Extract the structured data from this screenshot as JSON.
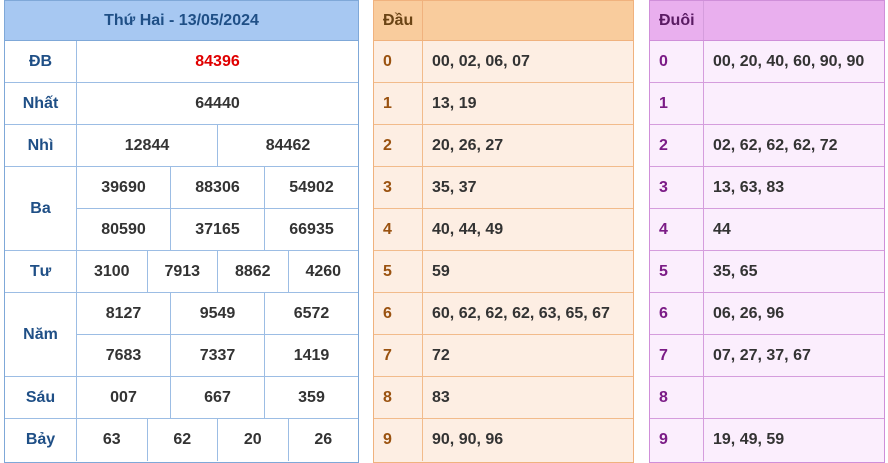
{
  "results": {
    "title": "Thứ Hai - 13/05/2024",
    "prizes": [
      {
        "label": "ĐB",
        "lines": [
          [
            "84396"
          ]
        ]
      },
      {
        "label": "Nhất",
        "lines": [
          [
            "64440"
          ]
        ]
      },
      {
        "label": "Nhì",
        "lines": [
          [
            "12844",
            "84462"
          ]
        ]
      },
      {
        "label": "Ba",
        "lines": [
          [
            "39690",
            "88306",
            "54902"
          ],
          [
            "80590",
            "37165",
            "66935"
          ]
        ]
      },
      {
        "label": "Tư",
        "lines": [
          [
            "3100",
            "7913",
            "8862",
            "4260"
          ]
        ]
      },
      {
        "label": "Năm",
        "lines": [
          [
            "8127",
            "9549",
            "6572"
          ],
          [
            "7683",
            "7337",
            "1419"
          ]
        ]
      },
      {
        "label": "Sáu",
        "lines": [
          [
            "007",
            "667",
            "359"
          ]
        ]
      },
      {
        "label": "Bảy",
        "lines": [
          [
            "63",
            "62",
            "20",
            "26"
          ]
        ]
      }
    ],
    "special_color": "#e00000"
  },
  "dau": {
    "header": "Đầu",
    "rows": [
      {
        "digit": "0",
        "nums": "00, 02, 06, 07"
      },
      {
        "digit": "1",
        "nums": "13, 19"
      },
      {
        "digit": "2",
        "nums": "20, 26, 27"
      },
      {
        "digit": "3",
        "nums": "35, 37"
      },
      {
        "digit": "4",
        "nums": "40, 44, 49"
      },
      {
        "digit": "5",
        "nums": "59"
      },
      {
        "digit": "6",
        "nums": "60, 62, 62, 62, 63, 65, 67"
      },
      {
        "digit": "7",
        "nums": "72"
      },
      {
        "digit": "8",
        "nums": "83"
      },
      {
        "digit": "9",
        "nums": "90, 90, 96"
      }
    ]
  },
  "duoi": {
    "header": "Đuôi",
    "rows": [
      {
        "digit": "0",
        "nums": "00, 20, 40, 60, 90, 90"
      },
      {
        "digit": "1",
        "nums": ""
      },
      {
        "digit": "2",
        "nums": "02, 62, 62, 62, 72"
      },
      {
        "digit": "3",
        "nums": "13, 63, 83"
      },
      {
        "digit": "4",
        "nums": "44"
      },
      {
        "digit": "5",
        "nums": "35, 65"
      },
      {
        "digit": "6",
        "nums": "06, 26, 96"
      },
      {
        "digit": "7",
        "nums": "07, 27, 37, 67"
      },
      {
        "digit": "8",
        "nums": ""
      },
      {
        "digit": "9",
        "nums": "19, 49, 59"
      }
    ]
  }
}
